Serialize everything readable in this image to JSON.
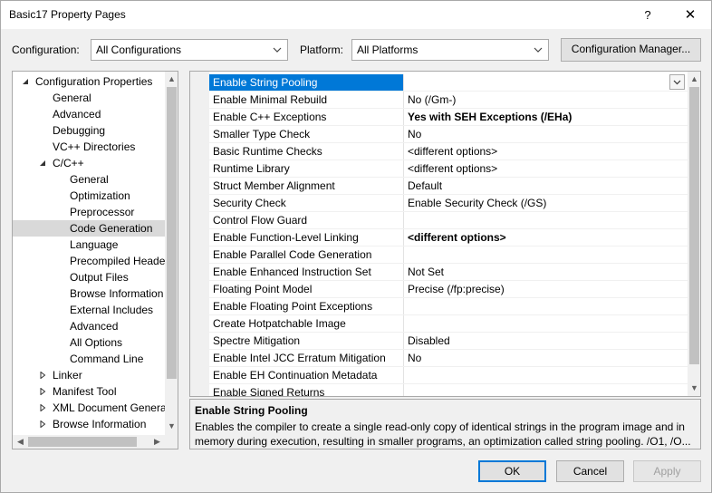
{
  "window": {
    "title": "Basic17 Property Pages",
    "help_glyph": "?",
    "close_glyph": "✕"
  },
  "config": {
    "configuration_label": "Configuration:",
    "configuration_value": "All Configurations",
    "platform_label": "Platform:",
    "platform_value": "All Platforms",
    "manager_button": "Configuration Manager..."
  },
  "tree": {
    "items": [
      {
        "label": "Configuration Properties",
        "expander": "expanded"
      },
      {
        "label": "General"
      },
      {
        "label": "Advanced"
      },
      {
        "label": "Debugging"
      },
      {
        "label": "VC++ Directories"
      },
      {
        "label": "C/C++",
        "expander": "expanded"
      },
      {
        "label": "General"
      },
      {
        "label": "Optimization"
      },
      {
        "label": "Preprocessor"
      },
      {
        "label": "Code Generation",
        "selected": true
      },
      {
        "label": "Language"
      },
      {
        "label": "Precompiled Heade"
      },
      {
        "label": "Output Files"
      },
      {
        "label": "Browse Information"
      },
      {
        "label": "External Includes"
      },
      {
        "label": "Advanced"
      },
      {
        "label": "All Options"
      },
      {
        "label": "Command Line"
      },
      {
        "label": "Linker",
        "expander": "collapsed"
      },
      {
        "label": "Manifest Tool",
        "expander": "collapsed"
      },
      {
        "label": "XML Document Genera",
        "expander": "collapsed"
      },
      {
        "label": "Browse Information",
        "expander": "collapsed"
      }
    ]
  },
  "properties": [
    {
      "name": "Enable String Pooling",
      "value": "",
      "selected": true
    },
    {
      "name": "Enable Minimal Rebuild",
      "value": "No (/Gm-)"
    },
    {
      "name": "Enable C++ Exceptions",
      "value": "Yes with SEH Exceptions (/EHa)",
      "bold": true
    },
    {
      "name": "Smaller Type Check",
      "value": "No"
    },
    {
      "name": "Basic Runtime Checks",
      "value": "<different options>"
    },
    {
      "name": "Runtime Library",
      "value": "<different options>"
    },
    {
      "name": "Struct Member Alignment",
      "value": "Default"
    },
    {
      "name": "Security Check",
      "value": "Enable Security Check (/GS)"
    },
    {
      "name": "Control Flow Guard",
      "value": ""
    },
    {
      "name": "Enable Function-Level Linking",
      "value": "<different options>",
      "bold": true
    },
    {
      "name": "Enable Parallel Code Generation",
      "value": ""
    },
    {
      "name": "Enable Enhanced Instruction Set",
      "value": "Not Set"
    },
    {
      "name": "Floating Point Model",
      "value": "Precise (/fp:precise)"
    },
    {
      "name": "Enable Floating Point Exceptions",
      "value": ""
    },
    {
      "name": "Create Hotpatchable Image",
      "value": ""
    },
    {
      "name": "Spectre Mitigation",
      "value": "Disabled"
    },
    {
      "name": "Enable Intel JCC Erratum Mitigation",
      "value": "No"
    },
    {
      "name": "Enable EH Continuation Metadata",
      "value": ""
    },
    {
      "name": "Enable Signed Returns",
      "value": ""
    }
  ],
  "description": {
    "title": "Enable String Pooling",
    "text": "Enables the compiler to create a single read-only copy of identical strings in the program image and in memory during execution, resulting in smaller programs, an optimization called string pooling. /O1, /O..."
  },
  "buttons": {
    "ok": "OK",
    "cancel": "Cancel",
    "apply": "Apply"
  },
  "colors": {
    "selection": "#0078d7",
    "tree_selection": "#d9d9d9"
  }
}
